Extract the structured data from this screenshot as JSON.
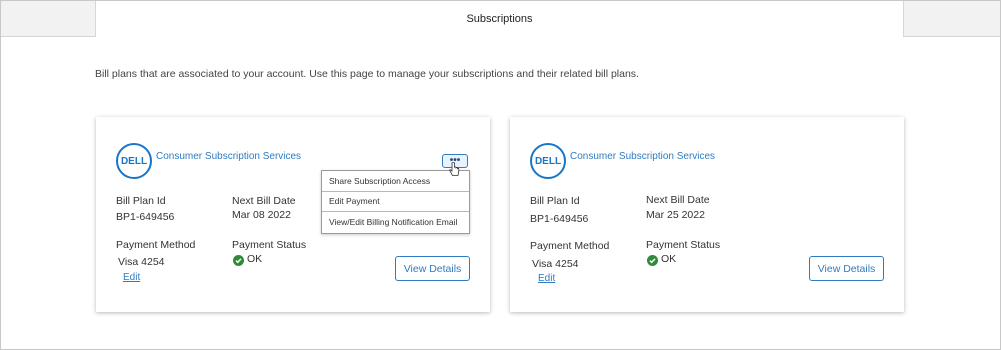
{
  "header": {
    "title": "Subscriptions"
  },
  "intro_text": "Bill plans that are associated to your account. Use this page to manage your subscriptions and their related bill plans.",
  "colors": {
    "accent": "#2f7cc2",
    "ok": "#2e8b3a",
    "logo": "#1776c8"
  },
  "cards": [
    {
      "logo_text": "DELL",
      "service_name": "Consumer Subscription Services",
      "bill_plan_label": "Bill Plan Id",
      "bill_plan_value": "BP1-649456",
      "next_bill_label": "Next Bill Date",
      "next_bill_value": "Mar 08 2022",
      "payment_method_label": "Payment Method",
      "payment_method_value": "Visa 4254",
      "edit_label": "Edit",
      "payment_status_label": "Payment Status",
      "payment_status_value": "OK",
      "view_details_label": "View Details",
      "more_label": "•••",
      "menu_items": [
        "Share Subscription Access",
        "Edit Payment",
        "View/Edit Billing Notification Email"
      ]
    },
    {
      "logo_text": "DELL",
      "service_name": "Consumer Subscription Services",
      "bill_plan_label": "Bill Plan Id",
      "bill_plan_value": "BP1-649456",
      "next_bill_label": "Next Bill Date",
      "next_bill_value": "Mar 25 2022",
      "payment_method_label": "Payment Method",
      "payment_method_value": "Visa 4254",
      "edit_label": "Edit",
      "payment_status_label": "Payment Status",
      "payment_status_value": "OK",
      "view_details_label": "View Details"
    }
  ]
}
